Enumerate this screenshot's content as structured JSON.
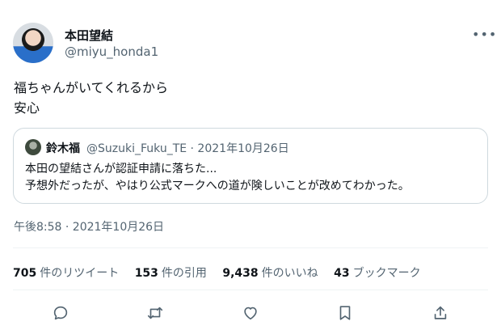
{
  "tweet": {
    "display_name": "本田望結",
    "handle": "@miyu_honda1",
    "more_icon": "more-icon",
    "text_lines": [
      "福ちゃんがいてくれるから",
      "安心"
    ],
    "timestamp": "午後8:58 · 2021年10月26日"
  },
  "quote": {
    "display_name": "鈴木福",
    "meta": "@Suzuki_Fuku_TE · 2021年10月26日",
    "text_lines": [
      "本田の望結さんが認証申請に落ちた...",
      "予想外だったが、やはり公式マークへの道が険しいことが改めてわかった。"
    ]
  },
  "stats": {
    "retweets": {
      "num": "705",
      "label": "件のリツイート"
    },
    "quotes": {
      "num": "153",
      "label": "件の引用"
    },
    "likes": {
      "num": "9,438",
      "label": "件のいいね"
    },
    "bookmarks": {
      "num": "43",
      "label": "ブックマーク"
    }
  },
  "actions": [
    "reply-icon",
    "retweet-icon",
    "like-icon",
    "bookmark-icon",
    "share-icon"
  ],
  "colors": {
    "text": "#0f1419",
    "secondary": "#536471",
    "border": "#cfd9de"
  }
}
